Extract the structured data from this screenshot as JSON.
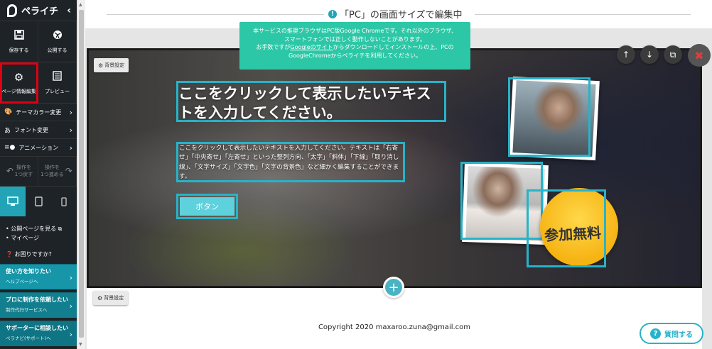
{
  "sidebar": {
    "logo": "ペライチ",
    "collapse_icon": "chevron-left-icon",
    "actions": [
      {
        "label": "保存する",
        "icon": "save-icon"
      },
      {
        "label": "公開する",
        "icon": "publish-icon"
      },
      {
        "label": "ページ情報編集",
        "icon": "gear-icon"
      },
      {
        "label": "プレビュー",
        "icon": "preview-icon"
      }
    ],
    "menu": [
      {
        "label": "テーマカラー変更",
        "icon": "palette-icon"
      },
      {
        "label": "フォント変更",
        "icon": "font-icon"
      },
      {
        "label": "アニメーション",
        "icon": "animation-icon"
      }
    ],
    "undo": {
      "line1": "操作を",
      "line2": "1つ戻す"
    },
    "redo": {
      "line1": "操作を",
      "line2": "1つ進める"
    },
    "devices": [
      "desktop-icon",
      "tablet-icon",
      "mobile-icon"
    ],
    "links": [
      "公開ページを見る",
      "マイページ"
    ],
    "help_question": "お困りですか？",
    "help_buttons": [
      {
        "title": "使い方を知りたい",
        "sub": "ヘルプページへ"
      },
      {
        "title": "プロに制作を依頼したい",
        "sub": "制作代行サービスへ"
      },
      {
        "title": "サポーターに相談したい",
        "sub": "ペラナビ(サポート)へ"
      }
    ]
  },
  "topbar": {
    "title": "「PC」の画面サイズで編集中"
  },
  "notice": {
    "line1": "本サービスの推奨ブラウザはPC版Google Chromeです。それ以外のブラウザ、",
    "line2": "スマートフォンでは正しく動作しないことがあります。",
    "line3_pre": "お手数ですが",
    "line3_link": "Googleのサイト",
    "line3_post": "からダウンロードしてインストールの上、PCの",
    "line4": "GoogleChromeからペライチを利用してください。"
  },
  "hero": {
    "bg_settings_label": "背景設定",
    "title": "ここをクリックして表示したいテキストを入力してください。",
    "body": "ここをクリックして表示したいテキストを入力してください。テキストは「右寄せ」「中央寄せ」「左寄せ」といった整列方向、「太字」「斜体」「下線」「取り消し線」、「文字サイズ」「文字色」「文字の背景色」など細かく編集することができます。",
    "button_label": "ボタン",
    "badge_text": "参加無料"
  },
  "footer": {
    "bg_settings_label": "背景設定",
    "copyright": "Copyright 2020 maxaroo.zuna@gmail.com",
    "help_button": "質問する"
  },
  "colors": {
    "sidebar_bg": "#1d2327",
    "accent": "#27b3c9",
    "notice_bg": "#2cc7a6",
    "highlight": "#e00012",
    "badge": "#f6b313"
  }
}
